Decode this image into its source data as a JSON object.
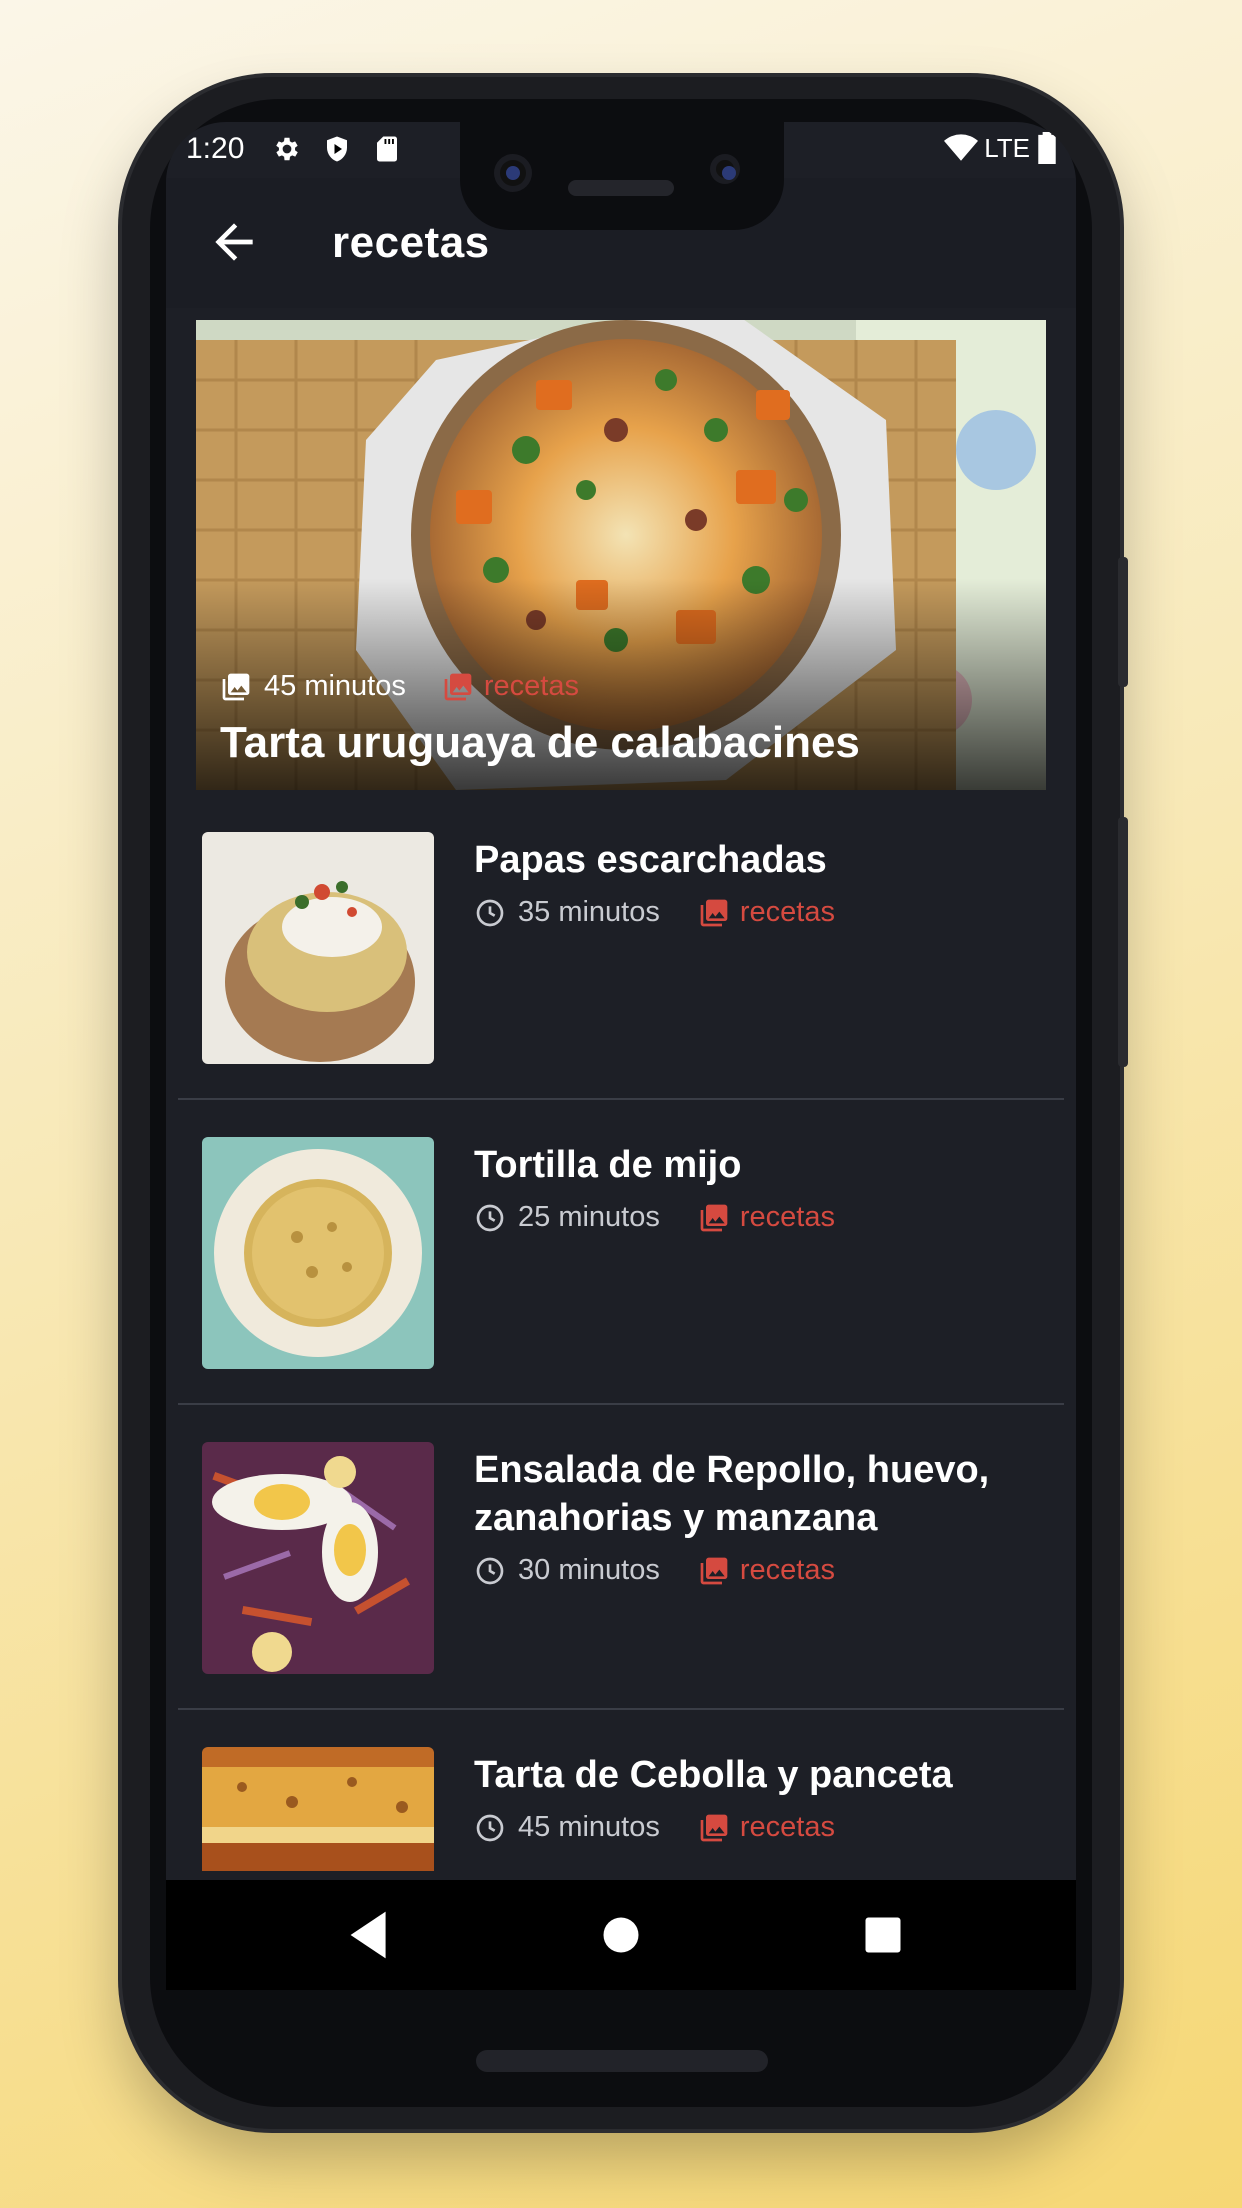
{
  "status_bar": {
    "time": "1:20",
    "network": "LTE"
  },
  "app_bar": {
    "title": "recetas"
  },
  "featured": {
    "time": "45 minutos",
    "category": "recetas",
    "title": "Tarta uruguaya de calabacines"
  },
  "recipes": [
    {
      "name": "Papas escarchadas",
      "time": "35 minutos",
      "category": "recetas"
    },
    {
      "name": "Tortilla de mijo",
      "time": "25 minutos",
      "category": "recetas"
    },
    {
      "name": "Ensalada de Repollo, huevo, zanahorias y manzana",
      "time": "30 minutos",
      "category": "recetas"
    },
    {
      "name": "Tarta de Cebolla y panceta",
      "time": "45 minutos",
      "category": "recetas"
    }
  ],
  "icons": {
    "back": "arrow-back-icon",
    "time_featured": "image-icon",
    "time_list": "clock-icon",
    "category": "photo-icon",
    "nav_back": "triangle-back-icon",
    "nav_home": "circle-home-icon",
    "nav_recents": "square-recents-icon"
  },
  "colors": {
    "accent": "#d54a40",
    "background": "#1d1f26"
  }
}
